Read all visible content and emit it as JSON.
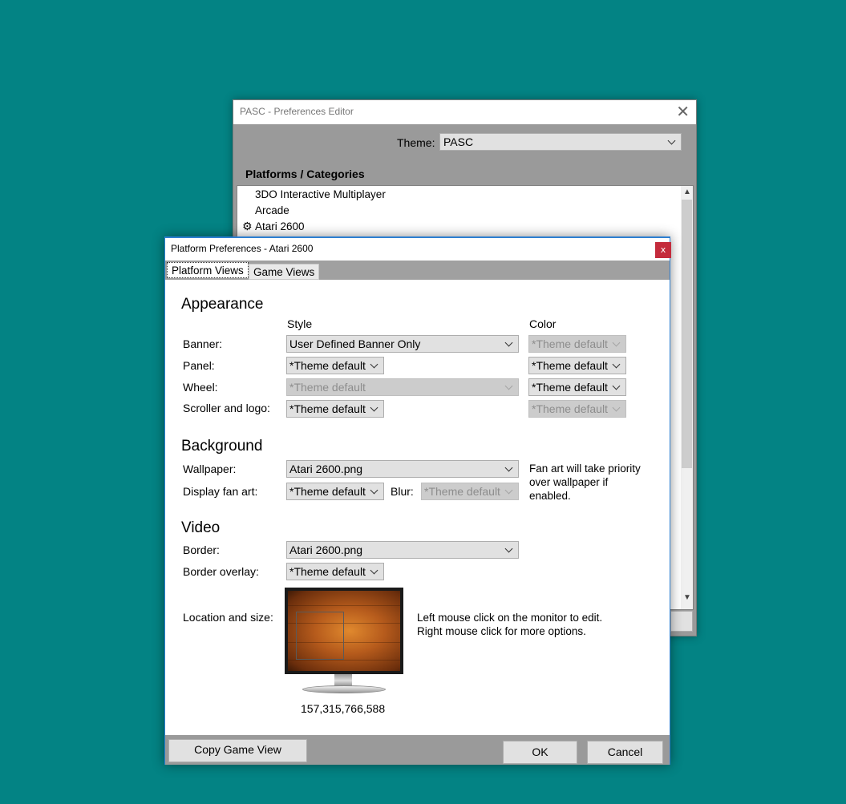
{
  "editor": {
    "title": "PASC - Preferences Editor",
    "close_glyph": "✕",
    "theme_label": "Theme:",
    "theme_value": "PASC",
    "platforms_heading": "Platforms / Categories",
    "platforms": [
      {
        "label": "3DO Interactive Multiplayer",
        "icon": ""
      },
      {
        "label": "Arcade",
        "icon": ""
      },
      {
        "label": "Atari 2600",
        "icon": "gear-icon"
      }
    ]
  },
  "dialog": {
    "title": "Platform Preferences - Atari 2600",
    "close_glyph": "x",
    "tabs": [
      "Platform Views",
      "Game Views"
    ],
    "appearance": {
      "title": "Appearance",
      "style_header": "Style",
      "color_header": "Color",
      "banner": {
        "label": "Banner:",
        "style": "User Defined Banner Only",
        "color": "*Theme default"
      },
      "panel": {
        "label": "Panel:",
        "style": "*Theme default",
        "color": "*Theme default"
      },
      "wheel": {
        "label": "Wheel:",
        "style": "*Theme default",
        "color": "*Theme default"
      },
      "scroller": {
        "label": "Scroller and logo:",
        "style": "*Theme default",
        "color": "*Theme default"
      }
    },
    "background": {
      "title": "Background",
      "wallpaper_label": "Wallpaper:",
      "wallpaper_value": "Atari 2600.png",
      "fanart_label": "Display fan art:",
      "fanart_value": "*Theme default",
      "blur_label": "Blur:",
      "blur_value": "*Theme default",
      "note_lines": [
        "Fan art will take priority",
        "over wallpaper if",
        "enabled."
      ]
    },
    "video": {
      "title": "Video",
      "border_label": "Border:",
      "border_value": "Atari 2600.png",
      "overlay_label": "Border overlay:",
      "overlay_value": "*Theme default",
      "location_label": "Location and size:",
      "coords": "157,315,766,588",
      "hint_lines": [
        "Left mouse click on the monitor to edit.",
        "Right mouse click for more options."
      ]
    },
    "buttons": {
      "copy": "Copy Game View",
      "ok": "OK",
      "cancel": "Cancel"
    }
  },
  "colors": {
    "desktop": "#038384",
    "close_red": "#c42b3c",
    "window_gray": "#9a9a9a"
  }
}
